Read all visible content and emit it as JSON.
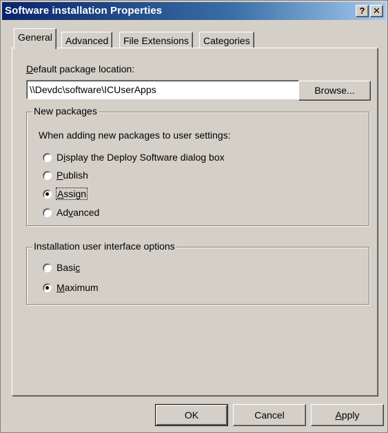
{
  "window": {
    "title": "Software installation Properties",
    "help_glyph": "?",
    "close_glyph": "✕"
  },
  "tabs": [
    {
      "label": "General",
      "active": true
    },
    {
      "label": "Advanced",
      "active": false
    },
    {
      "label": "File Extensions",
      "active": false
    },
    {
      "label": "Categories",
      "active": false
    }
  ],
  "general": {
    "location_label": "Default package location:",
    "location_label_accel": "D",
    "location_label_rest": "efault package location:",
    "location_value": "\\\\Devdc\\software\\ICUserApps",
    "browse_label": "Browse...",
    "new_packages": {
      "title": "New packages",
      "prompt": "When adding new packages to user settings:",
      "options": [
        {
          "pre": "D",
          "accel": "i",
          "post": "splay the Deploy Software dialog box",
          "checked": false
        },
        {
          "pre": "",
          "accel": "P",
          "post": "ublish",
          "checked": false
        },
        {
          "pre": "",
          "accel": "A",
          "post": "ssign",
          "checked": true
        },
        {
          "pre": "Ad",
          "accel": "v",
          "post": "anced",
          "checked": false
        }
      ]
    },
    "ui_options": {
      "title": "Installation user interface options",
      "options": [
        {
          "pre": "Basi",
          "accel": "c",
          "post": "",
          "checked": false
        },
        {
          "pre": "",
          "accel": "M",
          "post": "aximum",
          "checked": true
        }
      ]
    }
  },
  "buttons": {
    "ok": "OK",
    "cancel": "Cancel",
    "apply_accel": "A",
    "apply_rest": "pply"
  }
}
